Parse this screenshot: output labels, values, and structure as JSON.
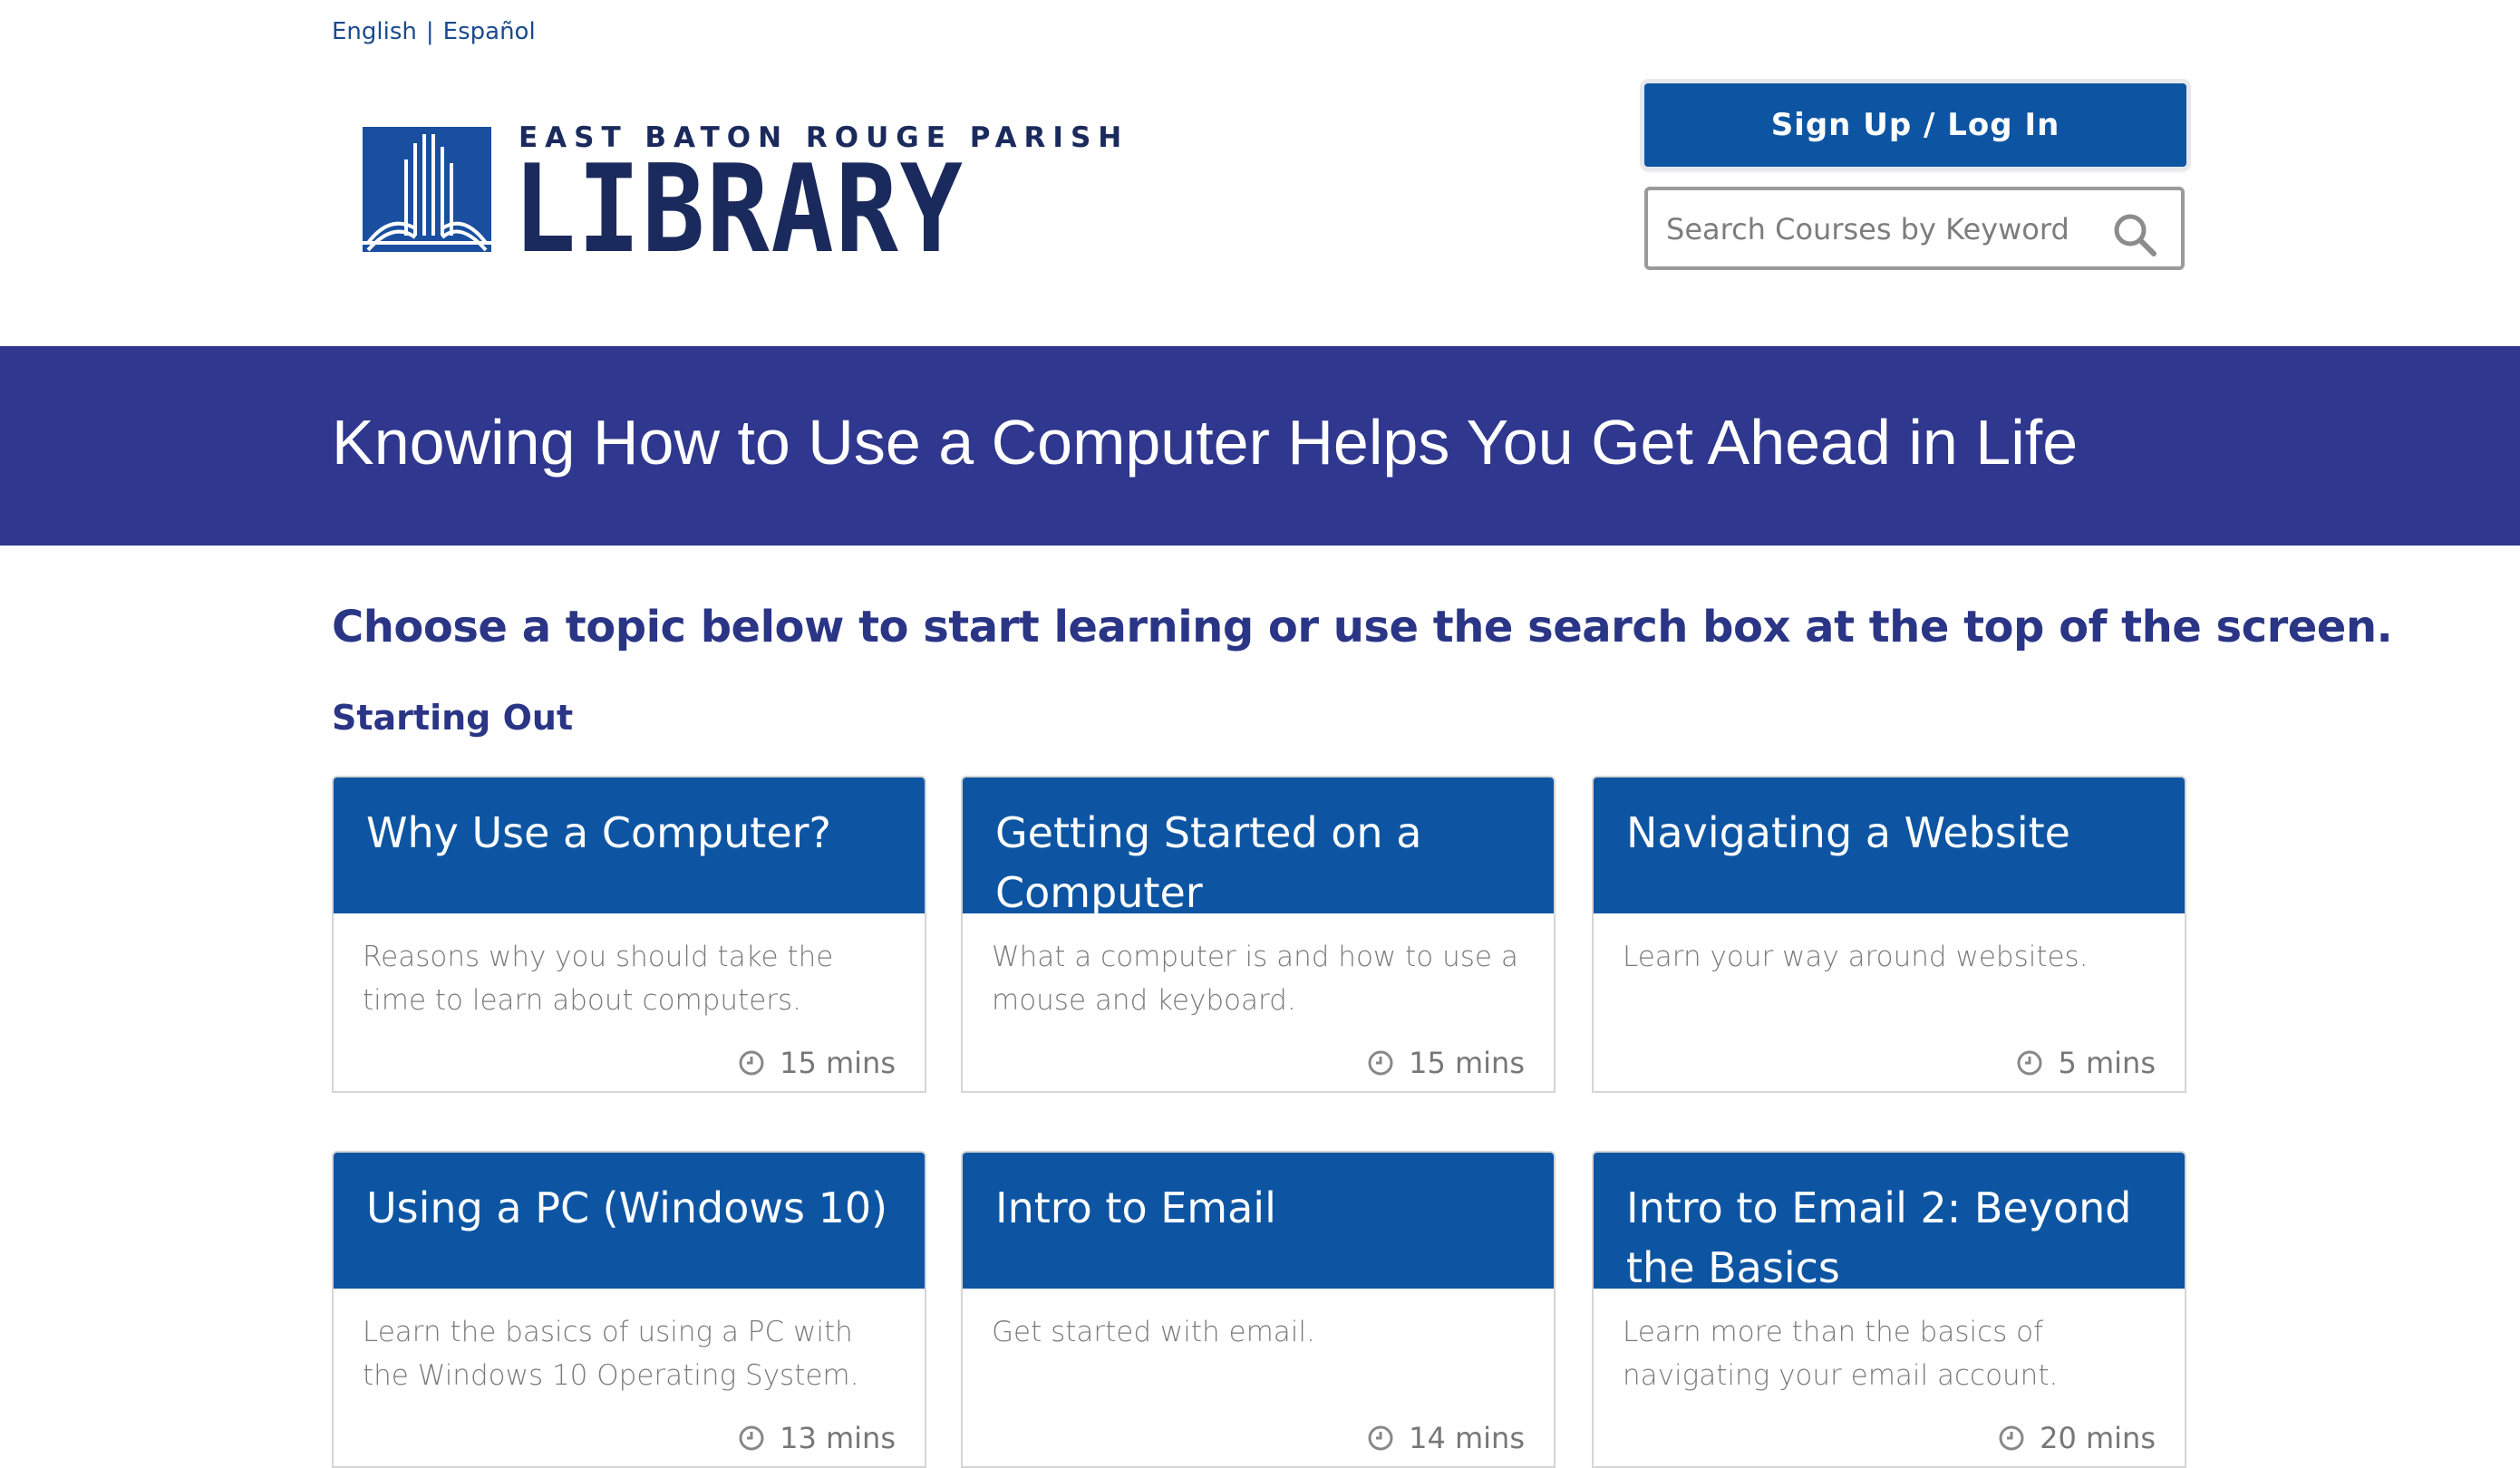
{
  "language": {
    "english": "English",
    "separator": "|",
    "spanish": "Español"
  },
  "logo": {
    "top_text": "EAST BATON ROUGE PARISH",
    "main_text": "LIBRARY"
  },
  "header": {
    "signup_label": "Sign Up / Log In",
    "search_placeholder": "Search Courses by Keyword",
    "search_icon": "search-icon"
  },
  "hero": {
    "title": "Knowing How to Use a Computer Helps You Get Ahead in Life"
  },
  "intro": "Choose a topic below to start learning or use the search box at the top of the screen.",
  "section": {
    "title": "Starting Out"
  },
  "colors": {
    "brand_blue": "#0d55a3",
    "hero_indigo": "#2f378e",
    "heading_navy": "#2a3586",
    "logo_navy": "#1b2a5c"
  },
  "courses": [
    {
      "title": "Why Use a Computer?",
      "description": "Reasons why you should take the time to learn about computers.",
      "duration": "15 mins"
    },
    {
      "title": "Getting Started on a Computer",
      "description": "What a computer is and how to use a mouse and keyboard.",
      "duration": "15 mins"
    },
    {
      "title": "Navigating a Website",
      "description": "Learn your way around websites.",
      "duration": "5 mins"
    },
    {
      "title": "Using a PC (Windows 10)",
      "description": "Learn the basics of using a PC with the Windows 10 Operating System.",
      "duration": "13 mins"
    },
    {
      "title": "Intro to Email",
      "description": "Get started with email.",
      "duration": "14 mins"
    },
    {
      "title": "Intro to Email 2: Beyond the Basics",
      "description": "Learn more than the basics of navigating your email account.",
      "duration": "20 mins"
    }
  ]
}
